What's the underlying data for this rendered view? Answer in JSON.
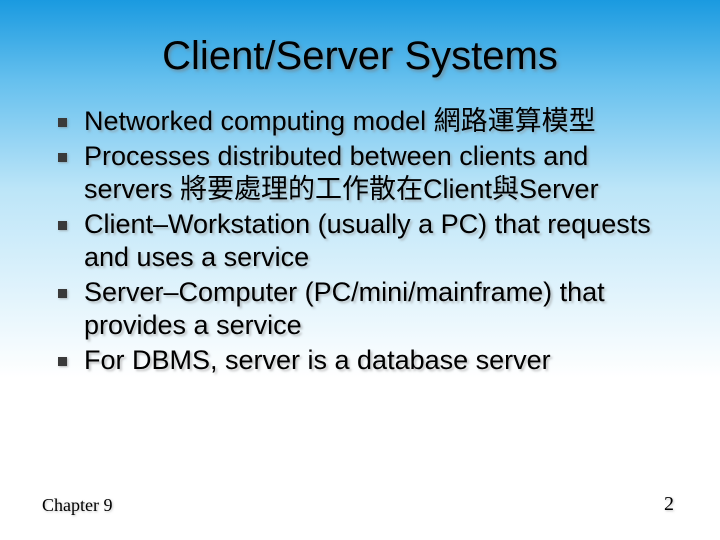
{
  "title": "Client/Server Systems",
  "bullets": [
    "Networked computing model 網路運算模型",
    "Processes distributed between clients and servers 將要處理的工作散在Client與Server",
    "Client–Workstation (usually a PC) that requests and uses a service",
    "Server–Computer (PC/mini/mainframe) that provides a service",
    "For DBMS, server is a database server"
  ],
  "footer": {
    "left": "Chapter 9",
    "right": "2"
  }
}
